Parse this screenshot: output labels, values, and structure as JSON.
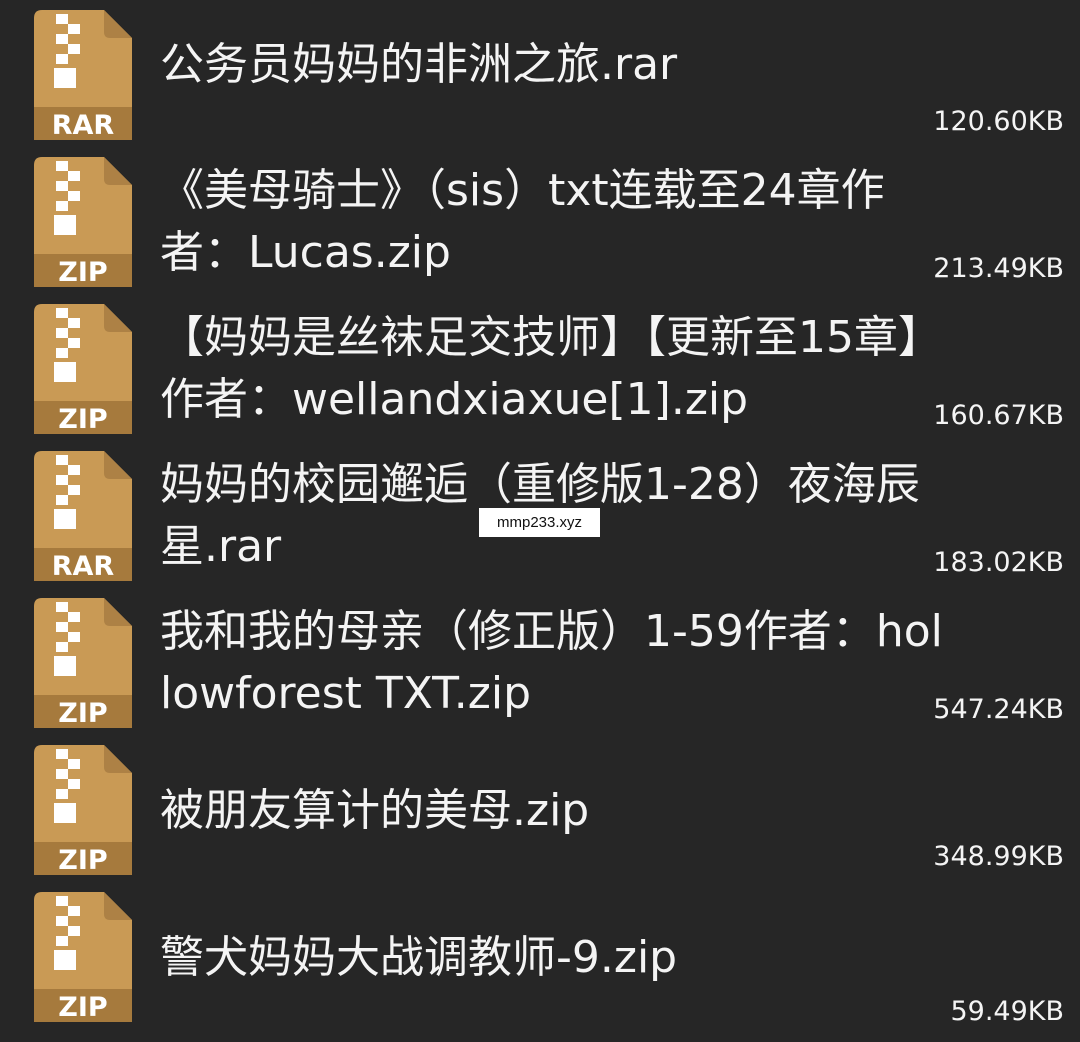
{
  "files": [
    {
      "name": "公务员妈妈的非洲之旅.rar",
      "type_label": "RAR",
      "size": "120.60KB",
      "icon": "archive-rar-icon"
    },
    {
      "name": "《美母骑士》（sis）txt连载至24章作者：Lucas.zip",
      "type_label": "ZIP",
      "size": "213.49KB",
      "icon": "archive-zip-icon"
    },
    {
      "name": "【妈妈是丝袜足交技师】【更新至15章】作者：wellandxiaxue[1].zip",
      "type_label": "ZIP",
      "size": "160.67KB",
      "icon": "archive-zip-icon"
    },
    {
      "name": "妈妈的校园邂逅（重修版1-28）夜海辰星.rar",
      "type_label": "RAR",
      "size": "183.02KB",
      "icon": "archive-rar-icon"
    },
    {
      "name": "我和我的母亲（修正版）1-59作者：hollowforest TXT.zip",
      "type_label": "ZIP",
      "size": "547.24KB",
      "icon": "archive-zip-icon"
    },
    {
      "name": "被朋友算计的美母.zip",
      "type_label": "ZIP",
      "size": "348.99KB",
      "icon": "archive-zip-icon"
    },
    {
      "name": "警犬妈妈大战调教师-9.zip",
      "type_label": "ZIP",
      "size": "59.49KB",
      "icon": "archive-zip-icon"
    }
  ],
  "watermark": "mmp233.xyz",
  "colors": {
    "background": "#262626",
    "icon_body": "#c99a55",
    "icon_fold": "#ad8145",
    "text": "#f4f4f4"
  }
}
